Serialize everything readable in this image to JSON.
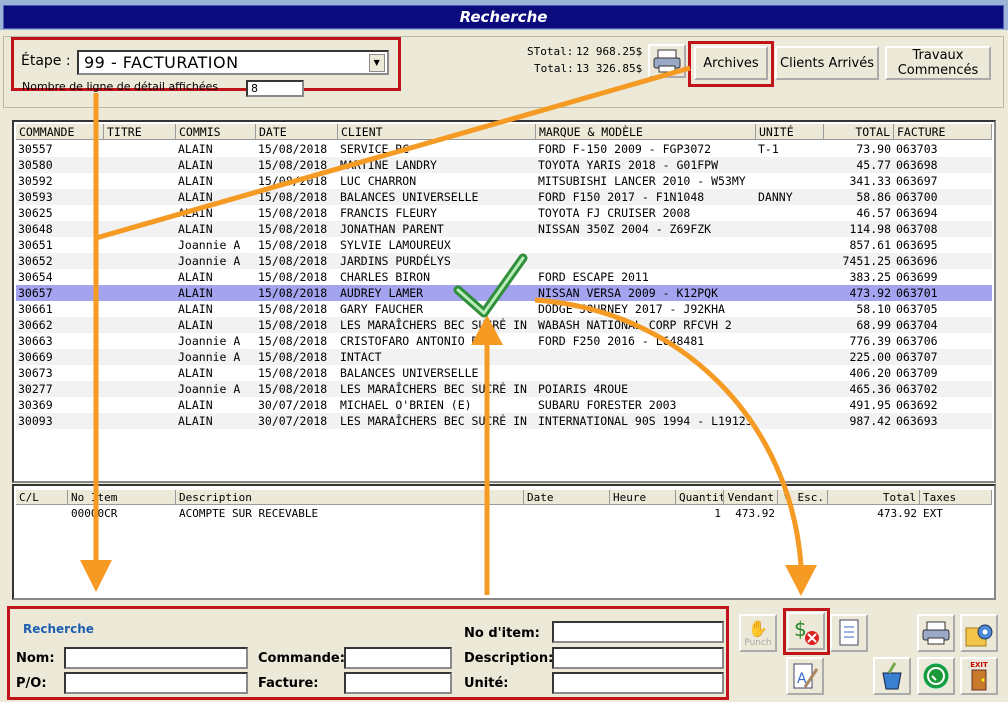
{
  "window": {
    "title": "Recherche"
  },
  "etape": {
    "label": "Étape :",
    "value": "99 - FACTURATION"
  },
  "detail_lines": {
    "label": "Nombre de ligne de détail affichées",
    "value": "8"
  },
  "totals": {
    "stotal_label": "STotal:",
    "stotal": "12 968.25$",
    "total_label": "Total:",
    "total": "13 326.85$"
  },
  "buttons": {
    "archives": "Archives",
    "clients": "Clients Arrivés",
    "travaux": "Travaux Commencés"
  },
  "grid": {
    "headers": [
      "COMMANDE",
      "TITRE",
      "COMMIS",
      "DATE",
      "CLIENT",
      "MARQUE & MODÈLE",
      "UNITÉ",
      "TOTAL",
      "FACTURE"
    ],
    "rows": [
      [
        "30557",
        "",
        "ALAIN",
        "15/08/2018",
        "SERVICE RC",
        "FORD F-150 2009 - FGP3072",
        "T-1",
        "73.90",
        "063703"
      ],
      [
        "30580",
        "",
        "ALAIN",
        "15/08/2018",
        "MARTINE LANDRY",
        "TOYOTA YARIS 2018 - G01FPW",
        "",
        "45.77",
        "063698"
      ],
      [
        "30592",
        "",
        "ALAIN",
        "15/08/2018",
        "LUC CHARRON",
        "MITSUBISHI LANCER 2010 - W53MY",
        "",
        "341.33",
        "063697"
      ],
      [
        "30593",
        "",
        "ALAIN",
        "15/08/2018",
        "BALANCES UNIVERSELLE",
        "FORD F150 2017 - F1N1048",
        "DANNY",
        "58.86",
        "063700"
      ],
      [
        "30625",
        "",
        "ALAIN",
        "15/08/2018",
        "FRANCIS FLEURY",
        "TOYOTA FJ CRUISER 2008",
        "",
        "46.57",
        "063694"
      ],
      [
        "30648",
        "",
        "ALAIN",
        "15/08/2018",
        "JONATHAN PARENT",
        "NISSAN 350Z 2004 - Z69FZK",
        "",
        "114.98",
        "063708"
      ],
      [
        "30651",
        "",
        "Joannie A",
        "15/08/2018",
        "SYLVIE LAMOUREUX",
        "",
        "",
        "857.61",
        "063695"
      ],
      [
        "30652",
        "",
        "Joannie A",
        "15/08/2018",
        "JARDINS PURDÉLYS",
        "",
        "",
        "7451.25",
        "063696"
      ],
      [
        "30654",
        "",
        "ALAIN",
        "15/08/2018",
        "CHARLES BIRON",
        "FORD ESCAPE 2011",
        "",
        "383.25",
        "063699"
      ],
      [
        "30657",
        "",
        "ALAIN",
        "15/08/2018",
        "AUDREY LAMER",
        "NISSAN VERSA 2009 - K12PQK",
        "",
        "473.92",
        "063701"
      ],
      [
        "30661",
        "",
        "ALAIN",
        "15/08/2018",
        "GARY FAUCHER",
        "DODGE JOURNEY 2017 - J92KHA",
        "",
        "58.10",
        "063705"
      ],
      [
        "30662",
        "",
        "ALAIN",
        "15/08/2018",
        "LES MARAÎCHERS BEC SUCRÉ IN",
        "WABASH NATIONAL CORP RFCVH 2",
        "",
        "68.99",
        "063704"
      ],
      [
        "30663",
        "",
        "Joannie A",
        "15/08/2018",
        "CRISTOFARO ANTONIO DE",
        "FORD F250 2016 - L648481",
        "",
        "776.39",
        "063706"
      ],
      [
        "30669",
        "",
        "Joannie A",
        "15/08/2018",
        "INTACT",
        "",
        "",
        "225.00",
        "063707"
      ],
      [
        "30673",
        "",
        "ALAIN",
        "15/08/2018",
        "BALANCES UNIVERSELLE",
        "",
        "",
        "406.20",
        "063709"
      ],
      [
        "30277",
        "",
        "Joannie A",
        "15/08/2018",
        "LES MARAÎCHERS BEC SUCRÉ IN",
        "POIARIS 4ROUE",
        "",
        "465.36",
        "063702"
      ],
      [
        "30369",
        "",
        "ALAIN",
        "30/07/2018",
        "MICHAEL O'BRIEN (E)",
        "SUBARU FORESTER 2003",
        "",
        "491.95",
        "063692"
      ],
      [
        "30093",
        "",
        "ALAIN",
        "30/07/2018",
        "LES MARAÎCHERS BEC SUCRÉ IN",
        "INTERNATIONAL 90S 1994 - L19125",
        "",
        "987.42",
        "063693"
      ]
    ],
    "selected_index": 9
  },
  "detail": {
    "headers": [
      "C/L",
      "No Item",
      "Description",
      "Date",
      "Heure",
      "Quantit",
      "Vendant",
      "% Esc.",
      "Total",
      "Taxes"
    ],
    "rows": [
      [
        "",
        "00000CR",
        "ACOMPTE SUR RECEVABLE",
        "",
        "",
        "1",
        "473.92",
        "",
        "473.92",
        "EXT"
      ]
    ]
  },
  "search": {
    "title": "Recherche",
    "nom": "Nom:",
    "commande": "Commande:",
    "noitem": "No d'item:",
    "po": "P/O:",
    "facture": "Facture:",
    "description": "Description:",
    "unite": "Unité:"
  },
  "toolbar": {
    "punch": "Punch",
    "exit": "EXIT"
  },
  "colors": {
    "accent_red": "#c0141b",
    "arrow_orange": "#f59a23",
    "selection": "#a3a3f0",
    "title_bg": "#0b0b7d"
  }
}
